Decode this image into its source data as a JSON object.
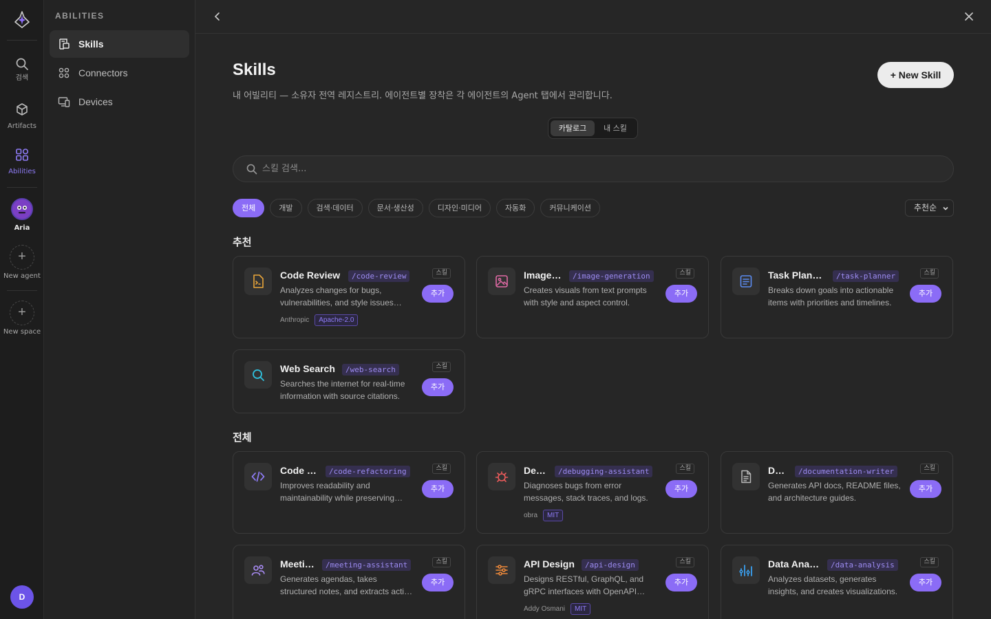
{
  "rail": {
    "items": [
      {
        "label": "검색",
        "icon": "search-icon"
      },
      {
        "label": "Artifacts",
        "icon": "cube-icon"
      },
      {
        "label": "Abilities",
        "icon": "grid-icon"
      },
      {
        "label": "Aria",
        "icon": "agent-avatar"
      },
      {
        "label": "New agent",
        "icon": "plus-icon"
      },
      {
        "label": "New space",
        "icon": "plus-icon"
      }
    ],
    "user_initial": "D"
  },
  "sidebar": {
    "title": "ABILITIES",
    "items": [
      {
        "label": "Skills",
        "icon": "skills-icon",
        "active": true
      },
      {
        "label": "Connectors",
        "icon": "connectors-icon",
        "active": false
      },
      {
        "label": "Devices",
        "icon": "devices-icon",
        "active": false
      }
    ]
  },
  "page": {
    "title": "Skills",
    "subtitle": "내 어빌리티 — 소유자 전역 레지스트리. 에이전트별 장착은 각 에이전트의 Agent 탭에서 관리합니다.",
    "new_button": "+ New Skill",
    "segments": [
      "카탈로그",
      "내 스킬"
    ],
    "active_segment": "카탈로그",
    "search_placeholder": "스킬 검색...",
    "filters": [
      "전체",
      "개발",
      "검색·데이터",
      "문서·생산성",
      "디자인·미디어",
      "자동화",
      "커뮤니케이션"
    ],
    "active_filter": "전체",
    "sort_label": "추천순"
  },
  "sections": {
    "recommended": "추천",
    "all": "전체"
  },
  "cards": {
    "add_label": "추가",
    "kind_label": "스킬",
    "recommended": [
      {
        "name": "Code Review",
        "slug": "/code-review",
        "desc": "Analyzes changes for bugs, vulnerabilities, and style issues before merging.",
        "author": "Anthropic",
        "license": "Apache-2.0",
        "icon": "code-file-icon",
        "color": "#e8a53a"
      },
      {
        "name": "Image Generation",
        "slug": "/image-generation",
        "desc": "Creates visuals from text prompts with style and aspect control.",
        "author": "",
        "license": "",
        "icon": "image-icon",
        "color": "#e26aa6"
      },
      {
        "name": "Task Planner",
        "slug": "/task-planner",
        "desc": "Breaks down goals into actionable items with priorities and timelines.",
        "author": "",
        "license": "",
        "icon": "task-list-icon",
        "color": "#5b8cf2"
      },
      {
        "name": "Web Search",
        "slug": "/web-search",
        "desc": "Searches the internet for real-time information with source citations.",
        "author": "",
        "license": "",
        "icon": "search-icon",
        "color": "#2fc3e0"
      }
    ],
    "all": [
      {
        "name": "Code Refactoring",
        "slug": "/code-refactoring",
        "desc": "Improves readability and maintainability while preserving behavior.",
        "author": "",
        "license": "",
        "icon": "code-brackets-icon",
        "color": "#8f7cf7"
      },
      {
        "name": "Debugging Assistant",
        "slug": "/debugging-assistant",
        "desc": "Diagnoses bugs from error messages, stack traces, and logs.",
        "author": "obra",
        "license": "MIT",
        "icon": "bug-icon",
        "color": "#ea5b5b"
      },
      {
        "name": "Documentation Writer",
        "slug": "/documentation-writer",
        "desc": "Generates API docs, README files, and architecture guides.",
        "author": "",
        "license": "",
        "icon": "document-icon",
        "color": "#b9b9b9"
      },
      {
        "name": "Meeting Assistant",
        "slug": "/meeting-assistant",
        "desc": "Generates agendas, takes structured notes, and extracts action items.",
        "author": "",
        "license": "",
        "icon": "people-icon",
        "color": "#a98cf5"
      },
      {
        "name": "API Design",
        "slug": "/api-design",
        "desc": "Designs RESTful, GraphQL, and gRPC interfaces with OpenAPI specs.",
        "author": "Addy Osmani",
        "license": "MIT",
        "icon": "sliders-icon",
        "color": "#f08a3a"
      },
      {
        "name": "Data Analysis",
        "slug": "/data-analysis",
        "desc": "Analyzes datasets, generates insights, and creates visualizations.",
        "author": "",
        "license": "",
        "icon": "chart-icon",
        "color": "#3aa0f0"
      }
    ]
  }
}
